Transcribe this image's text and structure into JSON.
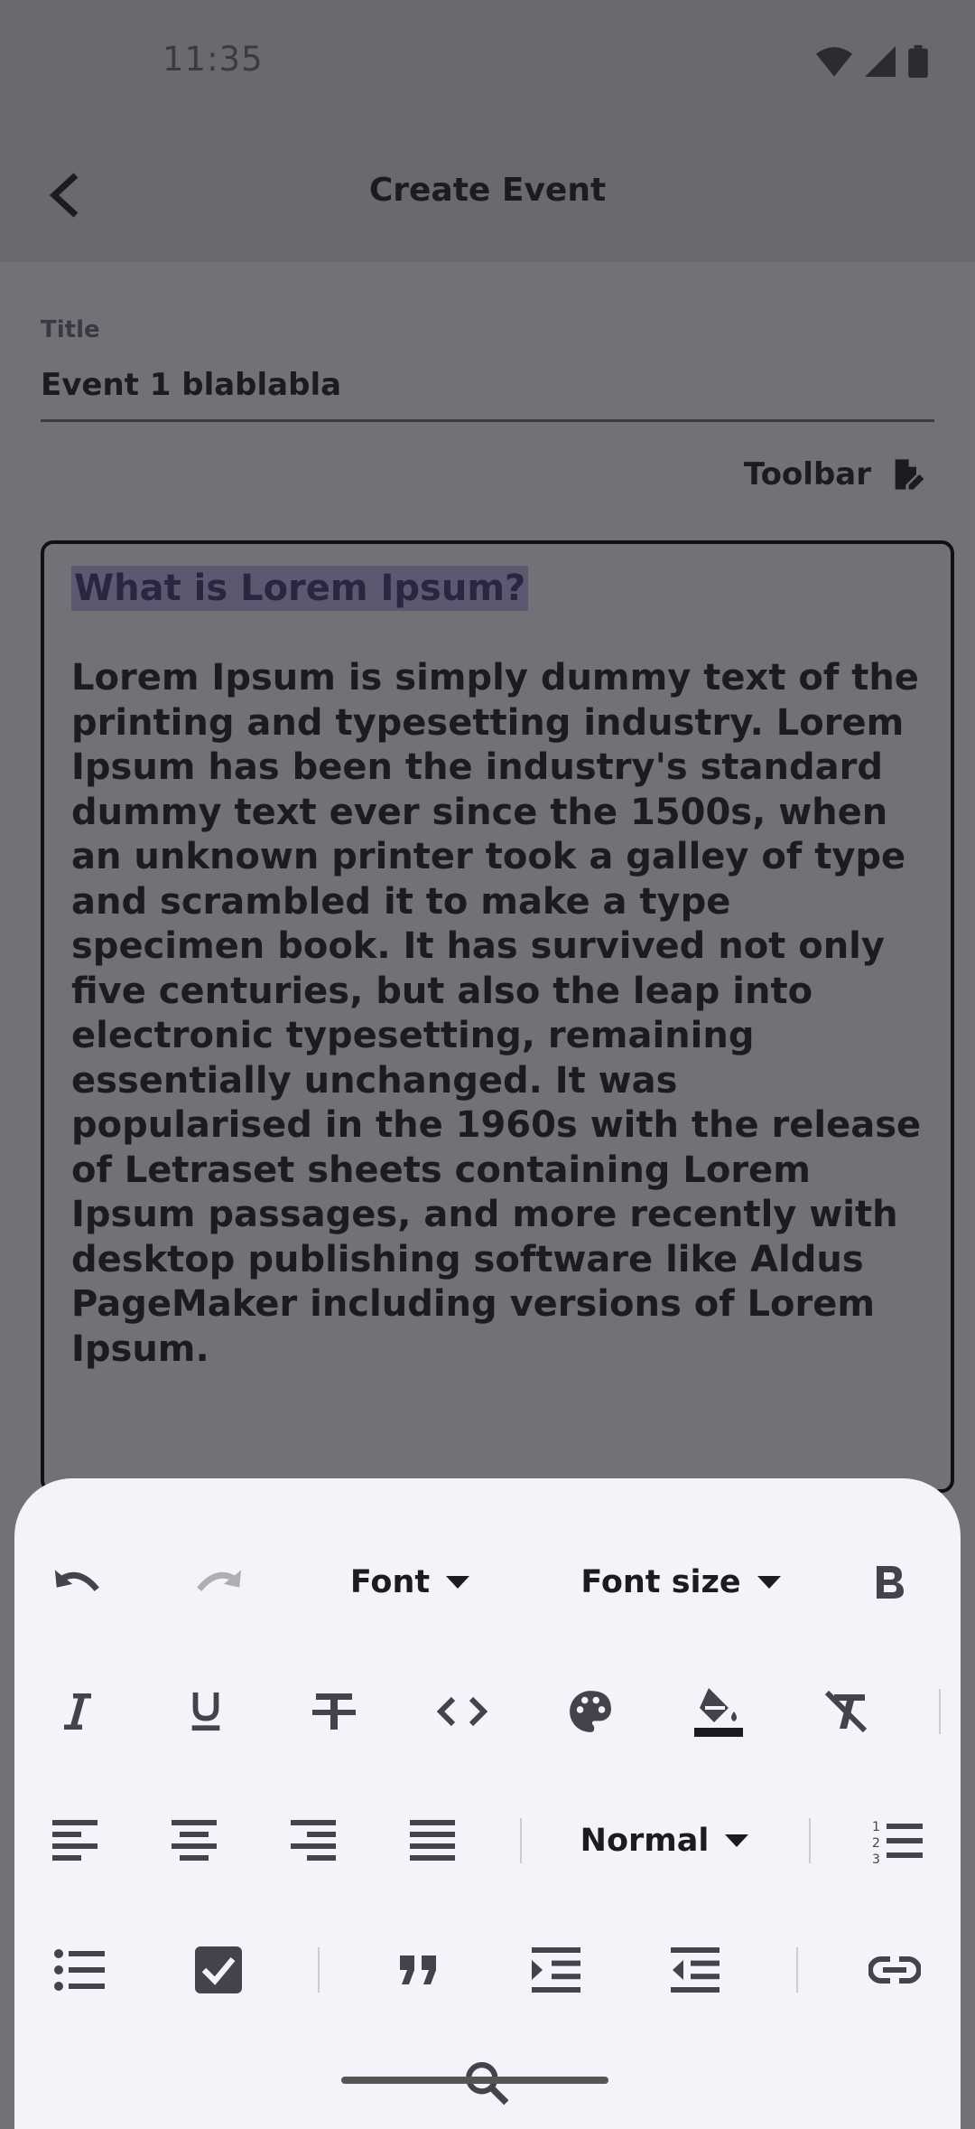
{
  "status_bar": {
    "time": "11:35",
    "icons": [
      "wifi-icon",
      "signal-icon",
      "battery-icon"
    ]
  },
  "app_bar": {
    "title": "Create Event",
    "back_icon": "arrow-back-icon"
  },
  "form": {
    "title_label": "Title",
    "title_value": "Event 1 blablabla",
    "toolbar_label": "Toolbar",
    "toolbar_icon": "edit-document-icon"
  },
  "editor": {
    "heading": "What is Lorem Ipsum?",
    "body": "Lorem Ipsum is simply dummy text of the printing and typesetting industry. Lorem Ipsum has been the industry's standard dummy text ever since the 1500s, when an unknown printer took a galley of type and scrambled it to make a type specimen book. It has survived not only five centuries, but also the leap into electronic typesetting, remaining essentially unchanged. It was popularised in the 1960s with the release of Letraset sheets containing Lorem Ipsum passages, and more recently with desktop publishing software like Aldus PageMaker including versions of Lorem Ipsum."
  },
  "format_toolbar": {
    "font_label": "Font",
    "font_size_label": "Font size",
    "header_style_label": "Normal",
    "buttons": [
      "undo-icon",
      "redo-icon",
      "bold-icon",
      "italic-icon",
      "underline-icon",
      "strikethrough-icon",
      "code-icon",
      "palette-icon",
      "fill-color-icon",
      "clear-format-icon",
      "align-left-icon",
      "align-center-icon",
      "align-right-icon",
      "align-justify-icon",
      "numbered-list-icon",
      "bullet-list-icon",
      "checklist-icon",
      "quote-icon",
      "indent-increase-icon",
      "indent-decrease-icon",
      "link-icon",
      "search-icon"
    ]
  },
  "colors": {
    "scrim": "#747077",
    "sheet": "#f6f2fa",
    "selection": "#5d5870",
    "text": "#1c1b1f"
  }
}
